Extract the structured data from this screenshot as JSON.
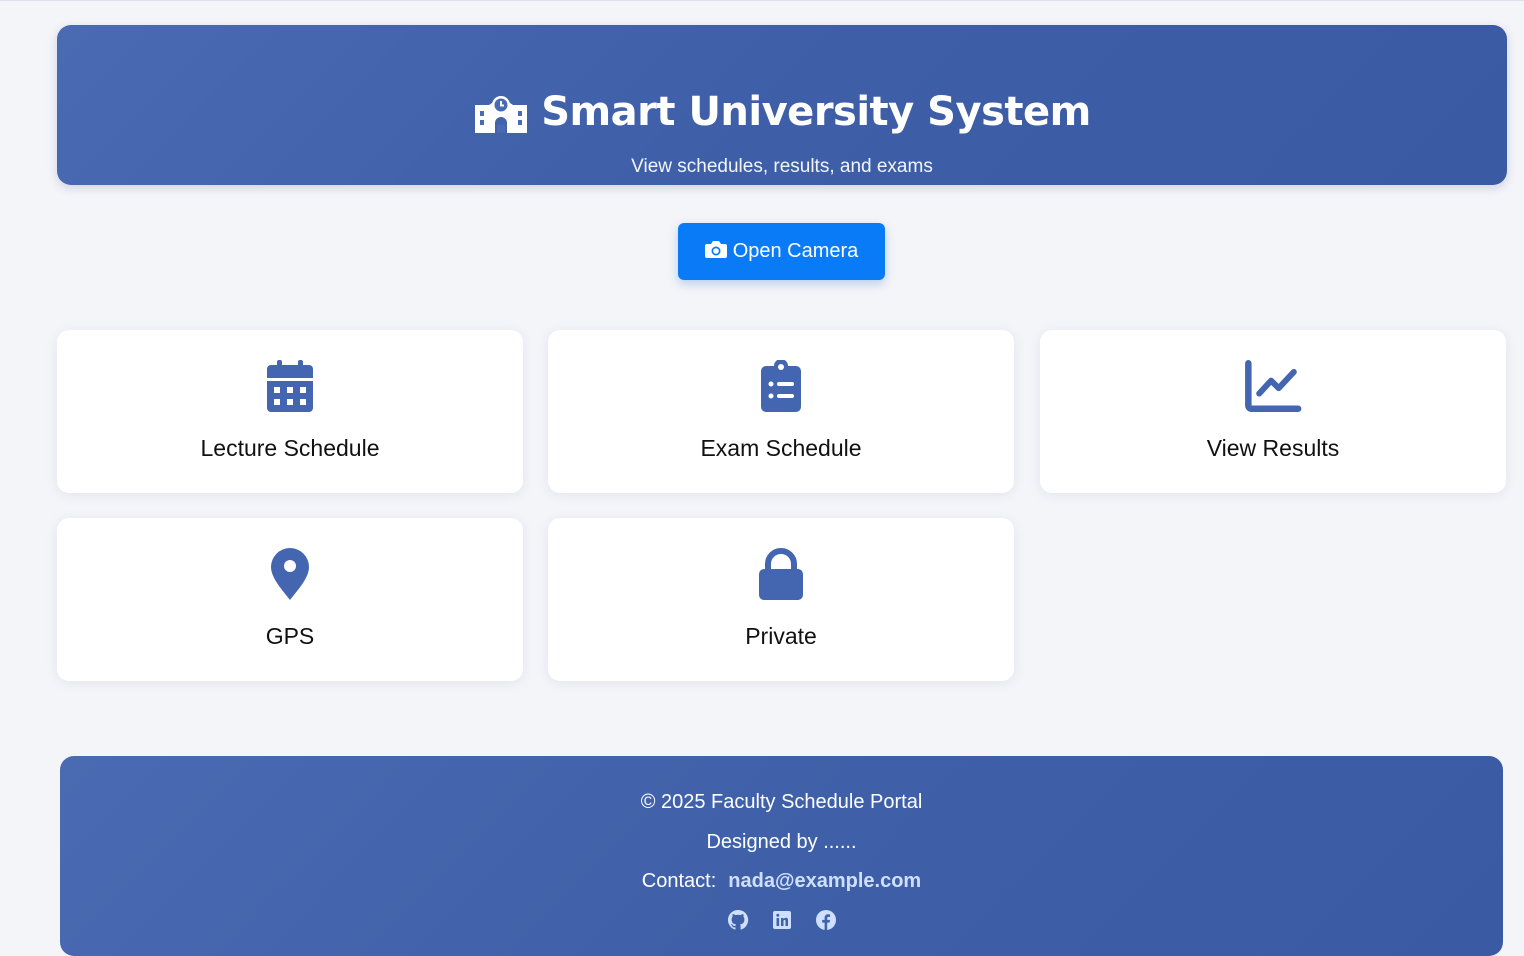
{
  "header": {
    "title": "Smart University System",
    "subtitle": "View schedules, results, and exams",
    "icon": "school-icon"
  },
  "camera_button": {
    "label": "Open Camera",
    "icon": "camera-icon",
    "color": "#0a7bf7"
  },
  "cards": [
    {
      "label": "Lecture Schedule",
      "icon": "calendar-icon"
    },
    {
      "label": "Exam Schedule",
      "icon": "clipboard-list-icon"
    },
    {
      "label": "View Results",
      "icon": "chart-line-icon"
    },
    {
      "label": "GPS",
      "icon": "location-pin-icon"
    },
    {
      "label": "Private",
      "icon": "lock-icon"
    }
  ],
  "footer": {
    "copyright": "© 2025 Faculty Schedule Portal",
    "designed_by": "Designed by ......",
    "contact_label": "Contact:",
    "contact_email": "nada@example.com",
    "socials": [
      "github-icon",
      "linkedin-icon",
      "facebook-icon"
    ]
  },
  "colors": {
    "brand": "#4063ab",
    "icon": "#4466b0",
    "background": "#f4f5f9"
  }
}
